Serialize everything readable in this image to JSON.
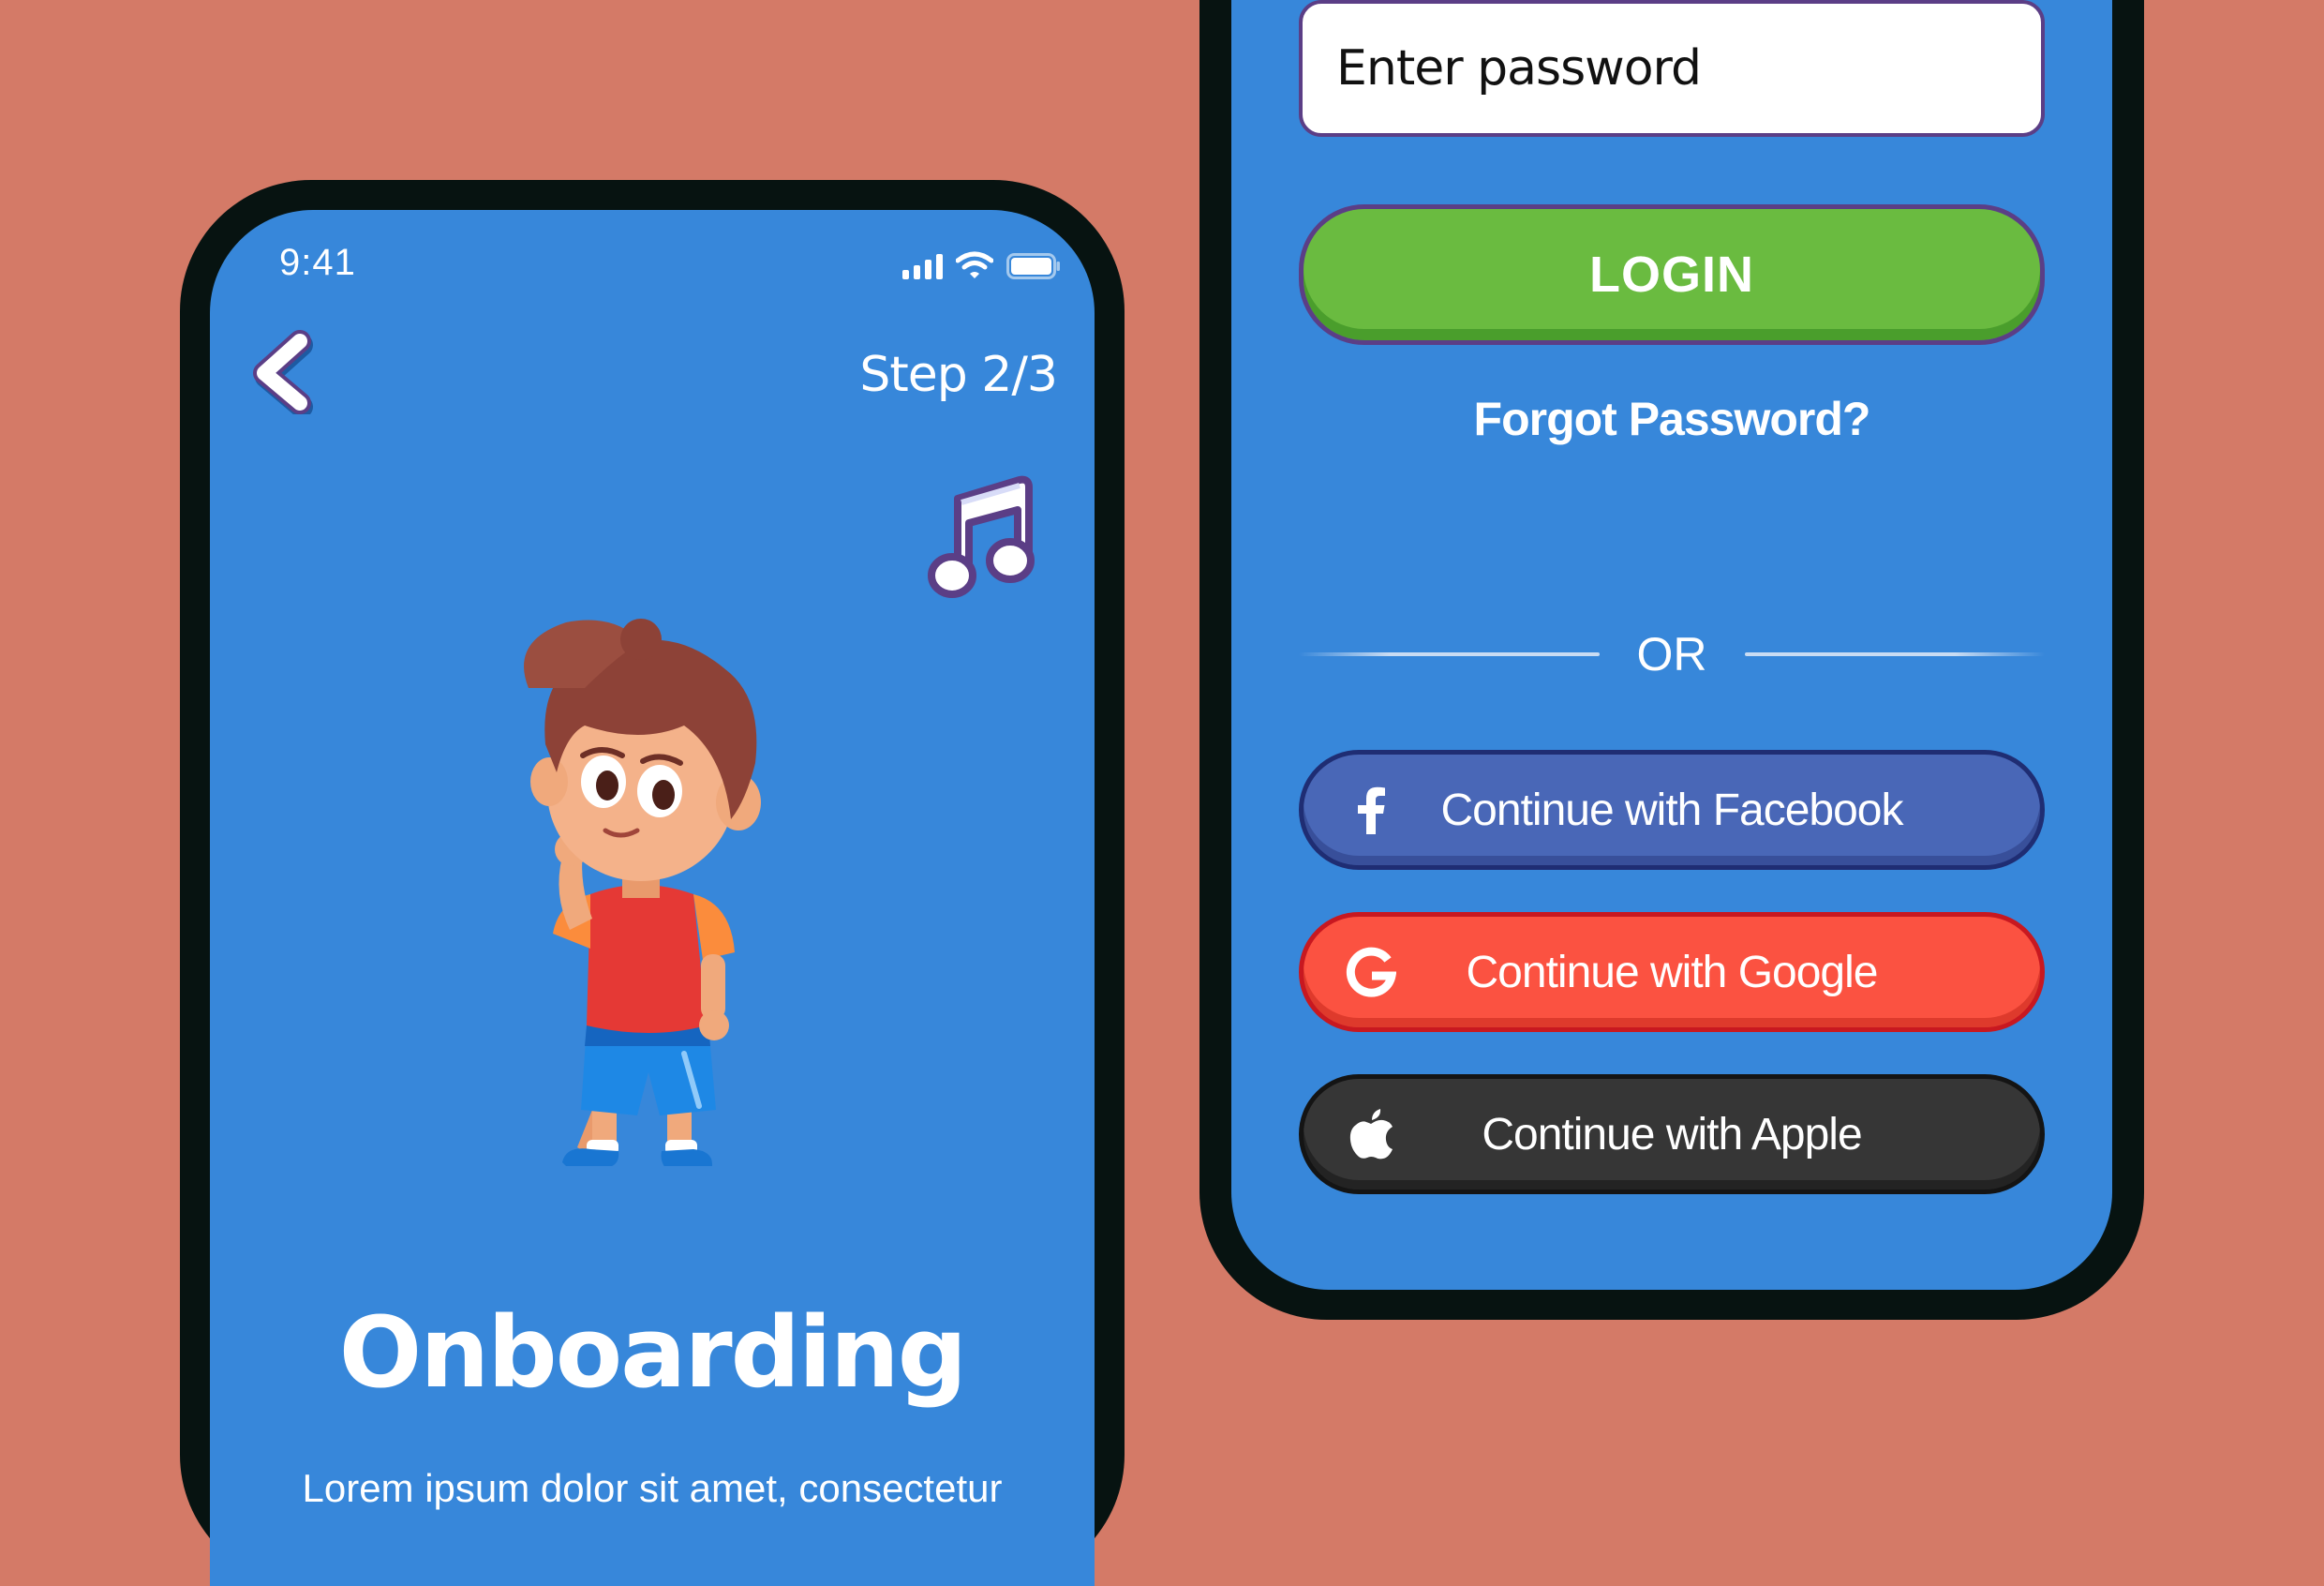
{
  "onboarding_screen": {
    "status_bar": {
      "time": "9:41",
      "icons": [
        "signal-icon",
        "wifi-icon",
        "battery-icon"
      ]
    },
    "back_icon": "chevron-left-icon",
    "step_label": "Step 2/3",
    "music_icon": "music-note-icon",
    "illustration": "cartoon-boy-thinking",
    "title": "Onboarding",
    "body": "Lorem ipsum dolor sit amet, consectetur"
  },
  "login_screen": {
    "password_field": {
      "placeholder": "Enter password"
    },
    "login_button": "LOGIN",
    "forgot_password": "Forgot Password?",
    "divider_text": "OR",
    "social_buttons": [
      {
        "label": "Continue with Facebook",
        "icon": "facebook-icon",
        "color": "#4967b7"
      },
      {
        "label": "Continue with Google",
        "icon": "google-icon",
        "color": "#fb5241"
      },
      {
        "label": "Continue with Apple",
        "icon": "apple-icon",
        "color": "#363636"
      }
    ]
  },
  "colors": {
    "background": "#d47a67",
    "screen": "#3787da",
    "phone_frame": "#071311",
    "login_green": "#6abb40",
    "outline_purple": "#5b3e86"
  }
}
